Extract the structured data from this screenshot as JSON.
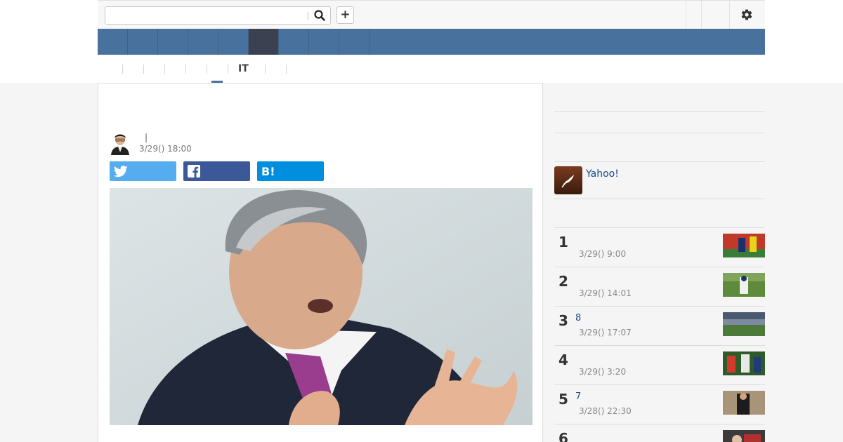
{
  "search": {
    "placeholder": "",
    "value": ""
  },
  "header": {
    "search_icon": "search-icon",
    "add_icon": "plus-icon",
    "add_label": "+",
    "settings_icon": "gear-icon"
  },
  "nav": {
    "brand_color": "#48729d",
    "active_tab_color": "#3b4150",
    "tab_count": 9,
    "active_index": 5
  },
  "subnav": {
    "active_label": "IT"
  },
  "article": {
    "title": "",
    "author_separator": "|",
    "date": "3/29() 18:00",
    "share": [
      {
        "service": "twitter",
        "icon": "twitter-icon",
        "color": "#55acee"
      },
      {
        "service": "facebook",
        "icon": "facebook-icon",
        "color": "#3b5998"
      },
      {
        "service": "hatena",
        "icon": "hatena-bookmark-icon",
        "label": "B!",
        "color": "#008fde"
      }
    ]
  },
  "sidebar": {
    "promo": {
      "icon": "yahoo-feather-icon",
      "label": "Yahoo!"
    },
    "ranking": [
      {
        "rank": "1",
        "title": "",
        "time": "3/29() 9:00"
      },
      {
        "rank": "2",
        "title": "",
        "time": "3/29() 14:01"
      },
      {
        "rank": "3",
        "title": "8",
        "time": "3/29() 17:07"
      },
      {
        "rank": "4",
        "title": "",
        "time": "3/29() 3:20"
      },
      {
        "rank": "5",
        "title": "7",
        "time": "3/28() 22:30"
      },
      {
        "rank": "6",
        "title": "",
        "time": ""
      }
    ]
  }
}
